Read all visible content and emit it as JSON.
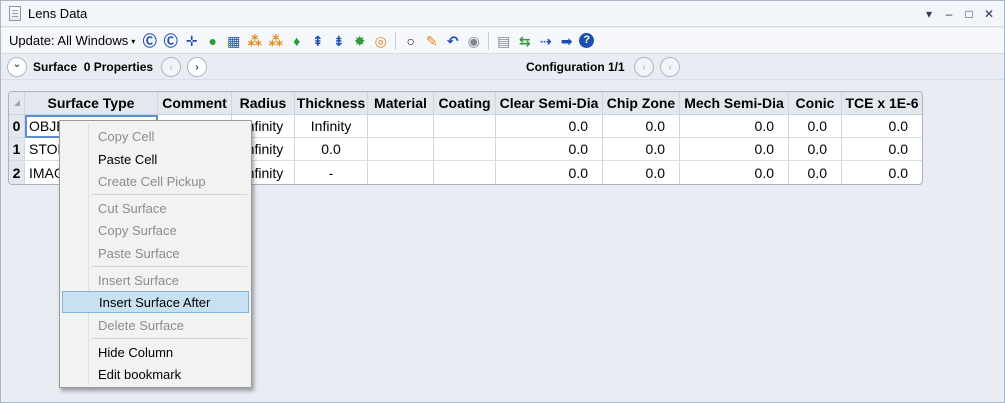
{
  "window": {
    "title": "Lens Data",
    "controls": [
      "▾",
      "–",
      "□",
      "✕"
    ]
  },
  "toolbar": {
    "update_label": "Update: All Windows",
    "caret": "▾",
    "icons": [
      {
        "name": "refresh-c-icon",
        "glyph": "Ⓒ"
      },
      {
        "name": "refresh-all-icon",
        "glyph": "Ⓒ"
      },
      {
        "name": "crosshair-icon",
        "glyph": "✛"
      },
      {
        "name": "globe-icon",
        "glyph": "●"
      },
      {
        "name": "layout-icon",
        "glyph": "▦"
      },
      {
        "name": "ray-fan-icon",
        "glyph": "⁂"
      },
      {
        "name": "ray-fan-2-icon",
        "glyph": "⁂"
      },
      {
        "name": "lens-icon",
        "glyph": "♦"
      },
      {
        "name": "axis-icon",
        "glyph": "⇞"
      },
      {
        "name": "cross-axis-icon",
        "glyph": "⇟"
      },
      {
        "name": "fish-icon",
        "glyph": "✸"
      },
      {
        "name": "target-icon",
        "glyph": "◎"
      },
      {
        "name": "ring-icon",
        "glyph": "○"
      },
      {
        "name": "pen-icon",
        "glyph": "✎"
      },
      {
        "name": "arrow-back-icon",
        "glyph": "↶"
      },
      {
        "name": "toggle-icon",
        "glyph": "◉"
      },
      {
        "name": "sheet-icon",
        "glyph": "▤"
      },
      {
        "name": "swap-icon",
        "glyph": "⇆"
      },
      {
        "name": "chain-icon",
        "glyph": "⇢"
      },
      {
        "name": "forward-icon",
        "glyph": "➡"
      },
      {
        "name": "help-icon",
        "glyph": "?"
      }
    ],
    "icon_colors": {
      "blue": "#1e4fb0",
      "green": "#2f9a3a",
      "orange": "#e08a1c",
      "gray": "#7d8896"
    }
  },
  "confbar": {
    "surface_label": "Surface  0 Properties",
    "configuration_label": "Configuration 1/1",
    "chevron_down": "⌄",
    "prev": "‹",
    "next": "›"
  },
  "table": {
    "headers": [
      "Surface Type",
      "Comment",
      "Radius",
      "Thickness",
      "Material",
      "Coating",
      "Clear Semi-Dia",
      "Chip Zone",
      "Mech Semi-Dia",
      "Conic",
      "TCE x 1E-6"
    ],
    "rows": [
      {
        "index": "0",
        "surface_type": "OBJECT Standard",
        "comment": "",
        "radius": "Infinity",
        "thickness": "Infinity",
        "material": "",
        "coating": "",
        "clear_semi_dia": "0.0",
        "chip_zone": "0.0",
        "mech_semi_dia": "0.0",
        "conic": "0.0",
        "tce": "0.0"
      },
      {
        "index": "1",
        "surface_type": "STOP Standard",
        "comment": "",
        "radius": "Infinity",
        "thickness": "0.0",
        "material": "",
        "coating": "",
        "clear_semi_dia": "0.0",
        "chip_zone": "0.0",
        "mech_semi_dia": "0.0",
        "conic": "0.0",
        "tce": "0.0"
      },
      {
        "index": "2",
        "surface_type": "IMAGE Standard",
        "comment": "",
        "radius": "Infinity",
        "thickness": "-",
        "material": "",
        "coating": "",
        "clear_semi_dia": "0.0",
        "chip_zone": "0.0",
        "mech_semi_dia": "0.0",
        "conic": "0.0",
        "tce": "0.0"
      }
    ]
  },
  "context_menu": {
    "items": [
      {
        "label": "Copy Cell",
        "enabled": false
      },
      {
        "label": "Paste Cell",
        "enabled": true
      },
      {
        "label": "Create Cell Pickup",
        "enabled": false
      },
      {
        "label": "Cut Surface",
        "enabled": false
      },
      {
        "label": "Copy Surface",
        "enabled": false
      },
      {
        "label": "Paste Surface",
        "enabled": false
      },
      {
        "label": "Insert Surface",
        "enabled": false
      },
      {
        "label": "Insert Surface After",
        "enabled": true,
        "highlighted": true
      },
      {
        "label": "Delete Surface",
        "enabled": false
      },
      {
        "label": "Hide Column",
        "enabled": true
      },
      {
        "label": "Edit bookmark",
        "enabled": true
      }
    ]
  }
}
